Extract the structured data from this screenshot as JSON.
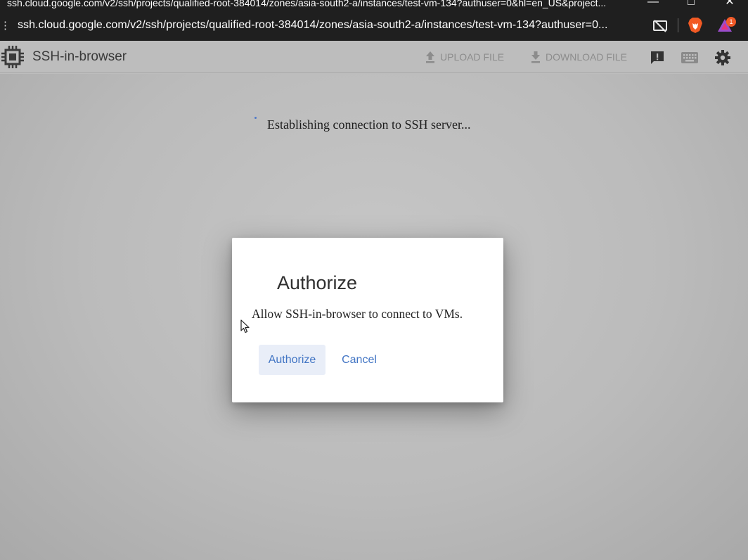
{
  "window": {
    "title": "ssh.cloud.google.com/v2/ssh/projects/qualified-root-384014/zones/asia-south2-a/instances/test-vm-134?authuser=0&hl=en_US&project..."
  },
  "browser": {
    "url": "ssh.cloud.google.com/v2/ssh/projects/qualified-root-384014/zones/asia-south2-a/instances/test-vm-134?authuser=0...",
    "rewards_badge_count": "1"
  },
  "header": {
    "title": "SSH-in-browser",
    "upload_label": "UPLOAD FILE",
    "download_label": "DOWNLOAD FILE"
  },
  "main": {
    "status": "Establishing connection to SSH server..."
  },
  "dialog": {
    "title": "Authorize",
    "message": "Allow SSH-in-browser to connect to VMs.",
    "authorize_label": "Authorize",
    "cancel_label": "Cancel"
  },
  "colors": {
    "accent": "#4275c4",
    "page_bg": "#bdbdbd",
    "titlebar_bg": "#1f1f1f"
  },
  "icons": [
    "chip-icon",
    "upload-icon",
    "download-icon",
    "feedback-icon",
    "keyboard-icon",
    "settings-icon",
    "cast-off-icon",
    "brave-lion-icon",
    "brave-rewards-icon"
  ]
}
